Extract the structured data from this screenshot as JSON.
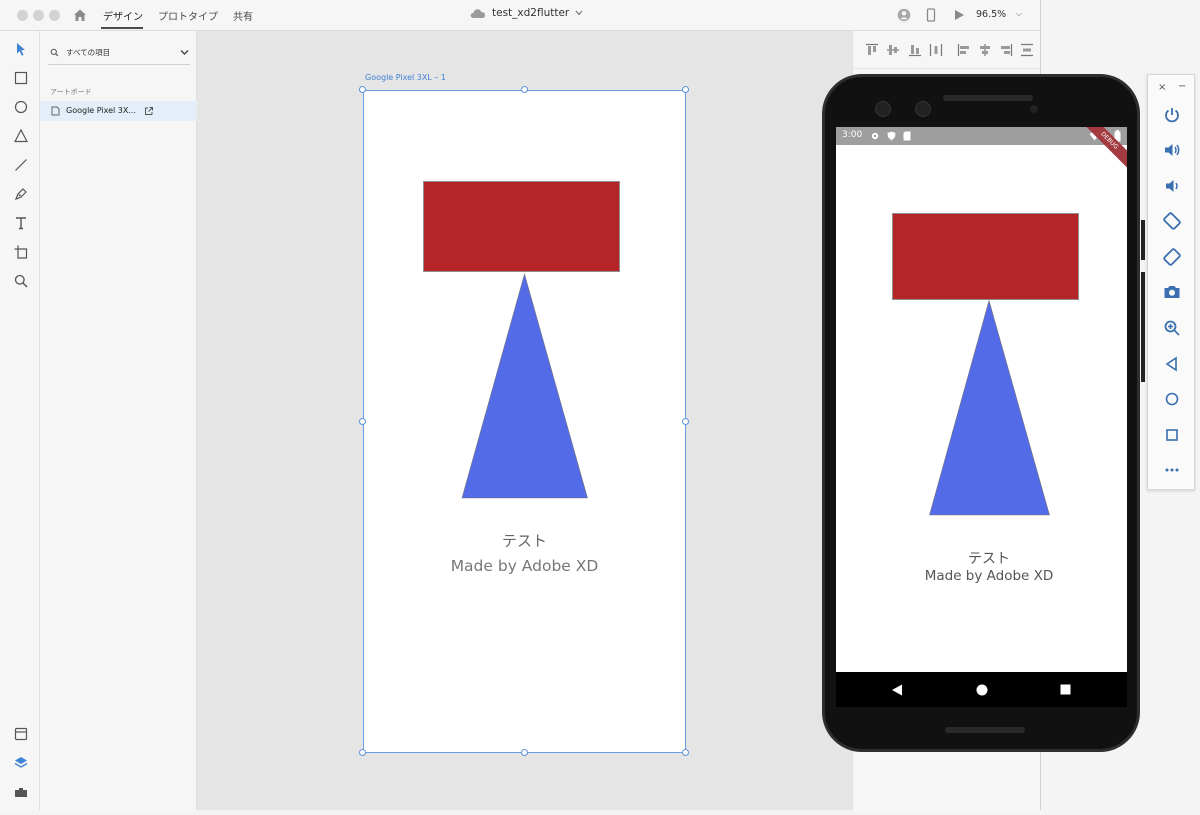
{
  "titlebar": {
    "tabs": [
      {
        "label": "デザイン",
        "active": true
      },
      {
        "label": "プロトタイプ",
        "active": false
      },
      {
        "label": "共有",
        "active": false
      }
    ],
    "document_title": "test_xd2flutter",
    "zoom": "96.5%"
  },
  "layers_panel": {
    "search_label": "すべての項目",
    "section_label": "アートボード",
    "artboard_item": "Google Pixel 3X..."
  },
  "canvas": {
    "artboard_label": "Google Pixel 3XL – 1",
    "text_line_1": "テスト",
    "text_line_2": "Made by Adobe XD"
  },
  "phone": {
    "status_time": "3:00",
    "debug_label": "DEBUG",
    "text_line_1": "テスト",
    "text_line_2": "Made by Adobe XD"
  },
  "emulator_controls": {
    "close": "×",
    "minimize": "−",
    "items": [
      "power-icon",
      "volume-up-icon",
      "volume-down-icon",
      "rotate-left-icon",
      "rotate-right-icon",
      "camera-icon",
      "zoom-icon",
      "back-icon",
      "home-icon",
      "overview-icon",
      "more-icon"
    ]
  },
  "colors": {
    "rect_fill": "#b52528",
    "triangle_fill": "#536be6",
    "selection_blue": "#3f83d6",
    "canvas_bg": "#e5e5e5"
  }
}
